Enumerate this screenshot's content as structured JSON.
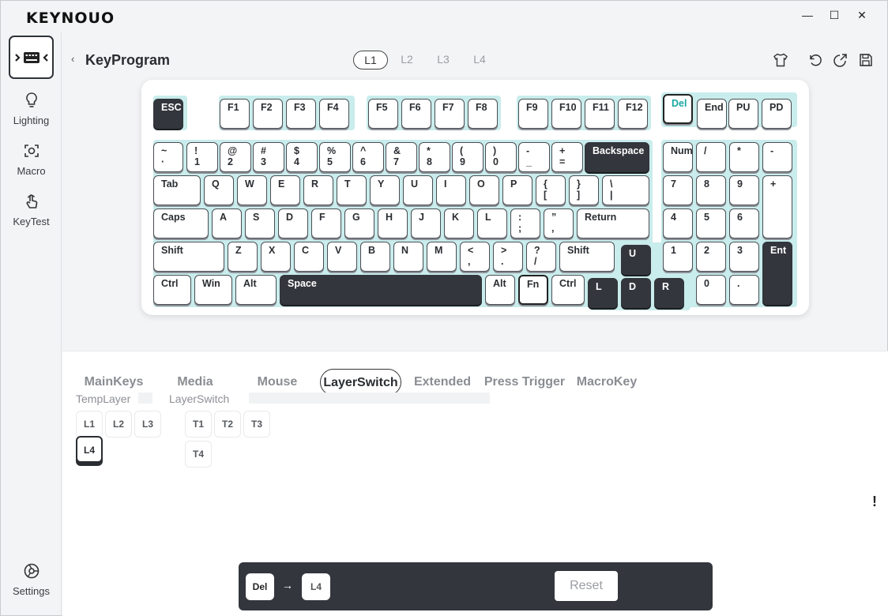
{
  "app": {
    "logo": "KEYNOUO"
  },
  "window": {
    "minimize": "—",
    "maximize": "☐",
    "close": "✕"
  },
  "sidebar": {
    "items": [
      {
        "label": "Lighting"
      },
      {
        "label": "Macro"
      },
      {
        "label": "KeyTest"
      }
    ],
    "settings": "Settings"
  },
  "header": {
    "back": "‹",
    "title": "KeyProgram",
    "layers": [
      "L1",
      "L2",
      "L3",
      "L4"
    ],
    "active_layer": "L1"
  },
  "keyboard": {
    "row0": [
      "ESC",
      "F1",
      "F2",
      "F3",
      "F4",
      "F5",
      "F6",
      "F7",
      "F8",
      "F9",
      "F10",
      "F11",
      "F12",
      "Del",
      "End",
      "PU",
      "PD"
    ],
    "row1": [
      [
        "~",
        "·"
      ],
      [
        "!",
        "1"
      ],
      [
        "@",
        "2"
      ],
      [
        "#",
        "3"
      ],
      [
        "$",
        "4"
      ],
      [
        "%",
        "5"
      ],
      [
        "^",
        "6"
      ],
      [
        "&",
        "7"
      ],
      [
        "*",
        "8"
      ],
      [
        "(",
        "9"
      ],
      [
        ")",
        "0"
      ],
      [
        "-",
        "_"
      ],
      [
        "+",
        "="
      ],
      [
        "Backspace",
        ""
      ],
      [
        "Num",
        ""
      ],
      [
        "/",
        ""
      ],
      [
        "*",
        ""
      ],
      [
        "-",
        ""
      ]
    ],
    "row2": [
      [
        "Tab",
        ""
      ],
      [
        "Q",
        ""
      ],
      [
        "W",
        ""
      ],
      [
        "E",
        ""
      ],
      [
        "R",
        ""
      ],
      [
        "T",
        ""
      ],
      [
        "Y",
        ""
      ],
      [
        "U",
        ""
      ],
      [
        "I",
        ""
      ],
      [
        "O",
        ""
      ],
      [
        "P",
        ""
      ],
      [
        "{",
        "["
      ],
      [
        "}",
        "]"
      ],
      [
        "\\",
        "|"
      ],
      [
        "7",
        ""
      ],
      [
        "8",
        ""
      ],
      [
        "9",
        ""
      ],
      [
        "+",
        ""
      ]
    ],
    "row3": [
      [
        "Caps",
        ""
      ],
      [
        "A",
        ""
      ],
      [
        "S",
        ""
      ],
      [
        "D",
        ""
      ],
      [
        "F",
        ""
      ],
      [
        "G",
        ""
      ],
      [
        "H",
        ""
      ],
      [
        "J",
        ""
      ],
      [
        "K",
        ""
      ],
      [
        "L",
        ""
      ],
      [
        ":",
        ";"
      ],
      [
        "”",
        ","
      ],
      [
        "Return",
        ""
      ],
      [
        "4",
        ""
      ],
      [
        "5",
        ""
      ],
      [
        "6",
        ""
      ]
    ],
    "row4": [
      [
        "Shift",
        ""
      ],
      [
        "Z",
        ""
      ],
      [
        "X",
        ""
      ],
      [
        "C",
        ""
      ],
      [
        "V",
        ""
      ],
      [
        "B",
        ""
      ],
      [
        "N",
        ""
      ],
      [
        "M",
        ""
      ],
      [
        "<",
        ","
      ],
      [
        ">",
        "."
      ],
      [
        "?",
        "/"
      ],
      [
        "Shift",
        ""
      ],
      [
        "U",
        ""
      ],
      [
        "1",
        ""
      ],
      [
        "2",
        ""
      ],
      [
        "3",
        ""
      ],
      [
        "Ent",
        ""
      ]
    ],
    "row5": [
      [
        "Ctrl",
        ""
      ],
      [
        "Win",
        ""
      ],
      [
        "Alt",
        ""
      ],
      [
        "Space",
        ""
      ],
      [
        "Alt",
        ""
      ],
      [
        "Fn",
        ""
      ],
      [
        "Ctrl",
        ""
      ],
      [
        "L",
        ""
      ],
      [
        "D",
        ""
      ],
      [
        "R",
        ""
      ],
      [
        "0",
        ""
      ],
      [
        ".",
        ""
      ]
    ]
  },
  "categories": [
    "MainKeys",
    "Media",
    "Mouse",
    "LayerSwitch",
    "Extended",
    "Press Trigger",
    "MacroKey"
  ],
  "active_category": "LayerSwitch",
  "temp_layer": {
    "label": "TempLayer",
    "keys": [
      "L1",
      "L2",
      "L3",
      "L4"
    ],
    "selected": "L4"
  },
  "layer_switch": {
    "label": "LayerSwitch",
    "keys": [
      "T1",
      "T2",
      "T3",
      "T4"
    ]
  },
  "mapping": {
    "from": "Del",
    "arrow": "→",
    "to": "L4",
    "reset": "Reset"
  },
  "hint": "!",
  "colors": {
    "accent": "#1aa7a3",
    "dark_key": "#33363c",
    "plate": "#c9ecec"
  }
}
